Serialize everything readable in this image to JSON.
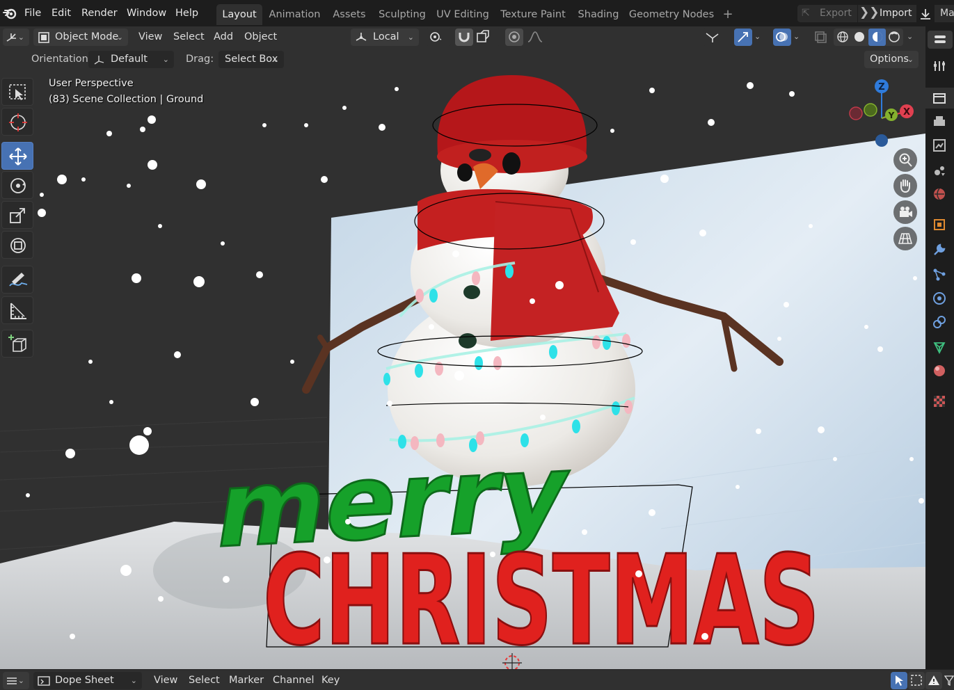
{
  "menubar": {
    "items": [
      "File",
      "Edit",
      "Render",
      "Window",
      "Help"
    ],
    "workspaces": [
      "Layout",
      "Animation",
      "Assets",
      "Sculpting",
      "UV Editing",
      "Texture Paint",
      "Shading",
      "Geometry Nodes"
    ],
    "active_workspace": "Layout",
    "add_tab_glyph": "+",
    "export_label": "Export",
    "import_label": "Import",
    "scene_label": "Ma"
  },
  "header": {
    "mode": "Object Mode",
    "menus": [
      "View",
      "Select",
      "Add",
      "Object"
    ],
    "transform_orientation": "Local",
    "orientation_label": "Orientation:",
    "orientation_value": "Default",
    "drag_label": "Drag:",
    "drag_value": "Select Box",
    "options_label": "Options"
  },
  "viewport": {
    "perspective": "User Perspective",
    "collection": "(83) Scene Collection | Ground",
    "scene_text_top": "merry",
    "scene_text_bottom": "CHRISTMAS",
    "axes": {
      "z": "Z",
      "y": "Y",
      "x": "X"
    }
  },
  "toolbar": {
    "tools": [
      "select-box",
      "cursor",
      "move",
      "rotate",
      "scale",
      "transform",
      "annotate",
      "measure",
      "add-cube"
    ],
    "active_tool": "move"
  },
  "colors": {
    "accent": "#4772b3",
    "header_bg": "#303030",
    "menubar_bg": "#1d1d1d",
    "axis_x": "#e04050",
    "axis_y": "#84b12e",
    "axis_z": "#2f7bdb"
  },
  "bottombar": {
    "editor": "Dope Sheet",
    "menus": [
      "View",
      "Select",
      "Marker",
      "Channel",
      "Key"
    ]
  }
}
